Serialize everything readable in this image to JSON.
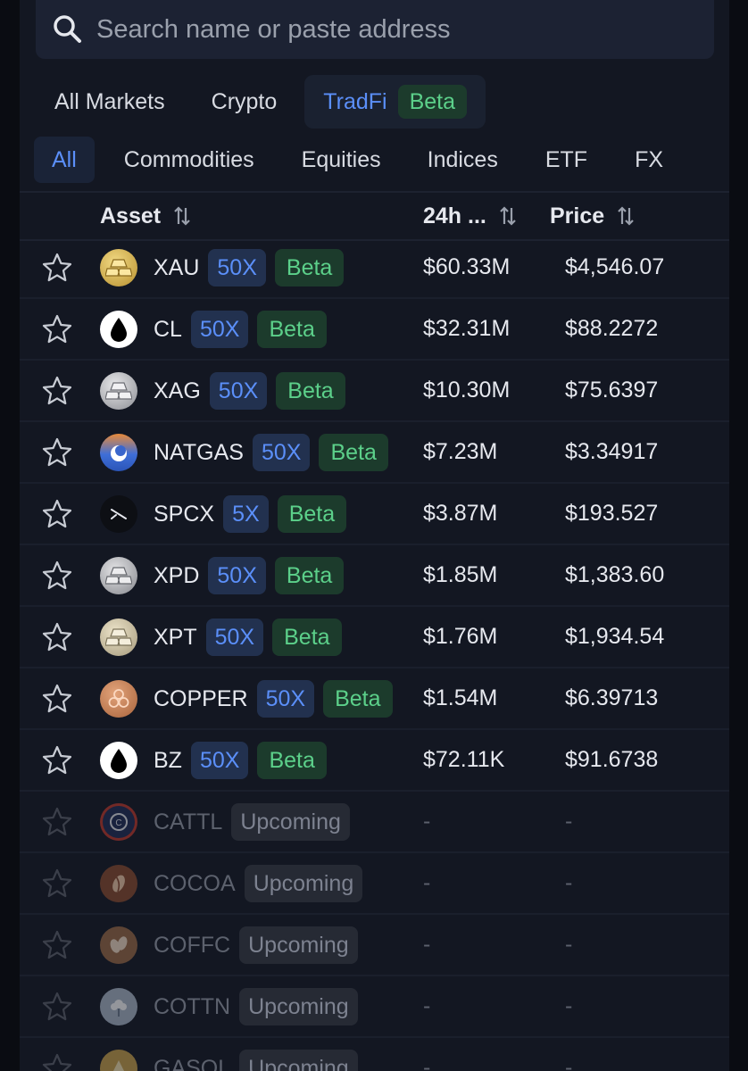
{
  "search": {
    "placeholder": "Search name or paste address"
  },
  "tabs": {
    "all_markets": "All Markets",
    "crypto": "Crypto",
    "tradfi": "TradFi",
    "tradfi_badge": "Beta"
  },
  "subtabs": {
    "all": "All",
    "commodities": "Commodities",
    "equities": "Equities",
    "indices": "Indices",
    "etf": "ETF",
    "fx": "FX"
  },
  "header": {
    "asset": "Asset",
    "volume": "24h ...",
    "price": "Price"
  },
  "rows": [
    {
      "symbol": "XAU",
      "leverage": "50X",
      "badge": "Beta",
      "volume": "$60.33M",
      "price": "$4,546.07",
      "icon": "gold-bars-icon"
    },
    {
      "symbol": "CL",
      "leverage": "50X",
      "badge": "Beta",
      "volume": "$32.31M",
      "price": "$88.2272",
      "icon": "oil-drop-icon"
    },
    {
      "symbol": "XAG",
      "leverage": "50X",
      "badge": "Beta",
      "volume": "$10.30M",
      "price": "$75.6397",
      "icon": "silver-bars-icon"
    },
    {
      "symbol": "NATGAS",
      "leverage": "50X",
      "badge": "Beta",
      "volume": "$7.23M",
      "price": "$3.34917",
      "icon": "gas-flame-icon"
    },
    {
      "symbol": "SPCX",
      "leverage": "5X",
      "badge": "Beta",
      "volume": "$3.87M",
      "price": "$193.527",
      "icon": "spacex-icon"
    },
    {
      "symbol": "XPD",
      "leverage": "50X",
      "badge": "Beta",
      "volume": "$1.85M",
      "price": "$1,383.60",
      "icon": "palladium-bars-icon"
    },
    {
      "symbol": "XPT",
      "leverage": "50X",
      "badge": "Beta",
      "volume": "$1.76M",
      "price": "$1,934.54",
      "icon": "platinum-bars-icon"
    },
    {
      "symbol": "COPPER",
      "leverage": "50X",
      "badge": "Beta",
      "volume": "$1.54M",
      "price": "$6.39713",
      "icon": "copper-icon"
    },
    {
      "symbol": "BZ",
      "leverage": "50X",
      "badge": "Beta",
      "volume": "$72.11K",
      "price": "$91.6738",
      "icon": "oil-drop-icon"
    },
    {
      "symbol": "CATTL",
      "badge": "Upcoming",
      "volume": "-",
      "price": "-",
      "icon": "catl-icon"
    },
    {
      "symbol": "COCOA",
      "badge": "Upcoming",
      "volume": "-",
      "price": "-",
      "icon": "cocoa-icon"
    },
    {
      "symbol": "COFFC",
      "badge": "Upcoming",
      "volume": "-",
      "price": "-",
      "icon": "coffee-bean-icon"
    },
    {
      "symbol": "COTTN",
      "badge": "Upcoming",
      "volume": "-",
      "price": "-",
      "icon": "cotton-icon"
    },
    {
      "symbol": "GASOL",
      "badge": "Upcoming",
      "volume": "-",
      "price": "-",
      "icon": "gasoline-icon"
    }
  ]
}
